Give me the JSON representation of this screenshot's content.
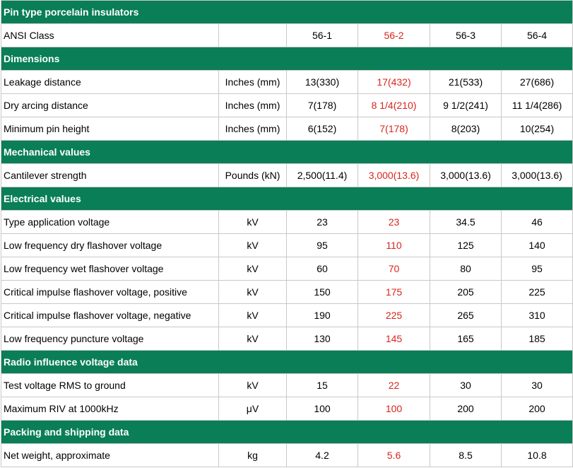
{
  "title": "Pin type porcelain insulators",
  "ansi": {
    "label": "ANSI Class",
    "classes": [
      "56-1",
      "56-2",
      "56-3",
      "56-4"
    ]
  },
  "accent_color": "#0a7e56",
  "highlight_color": "#d9251d",
  "sections": [
    {
      "title": "Dimensions",
      "rows": [
        {
          "label": "Leakage distance",
          "unit": "Inches (mm)",
          "values": [
            "13(330)",
            "17(432)",
            "21(533)",
            "27(686)"
          ]
        },
        {
          "label": "Dry arcing distance",
          "unit": "Inches (mm)",
          "values": [
            "7(178)",
            "8 1/4(210)",
            "9 1/2(241)",
            "11 1/4(286)"
          ]
        },
        {
          "label": "Minimum pin height",
          "unit": "Inches (mm)",
          "values": [
            "6(152)",
            "7(178)",
            "8(203)",
            "10(254)"
          ]
        }
      ]
    },
    {
      "title": "Mechanical values",
      "rows": [
        {
          "label": "Cantilever strength",
          "unit": "Pounds (kN)",
          "values": [
            "2,500(11.4)",
            "3,000(13.6)",
            "3,000(13.6)",
            "3,000(13.6)"
          ]
        }
      ]
    },
    {
      "title": "Electrical values",
      "rows": [
        {
          "label": "Type application voltage",
          "unit": "kV",
          "values": [
            "23",
            "23",
            "34.5",
            "46"
          ]
        },
        {
          "label": "Low frequency dry flashover voltage",
          "unit": "kV",
          "values": [
            "95",
            "110",
            "125",
            "140"
          ]
        },
        {
          "label": "Low frequency wet flashover voltage",
          "unit": "kV",
          "values": [
            "60",
            "70",
            "80",
            "95"
          ]
        },
        {
          "label": "Critical impulse flashover voltage, positive",
          "unit": "kV",
          "values": [
            "150",
            "175",
            "205",
            "225"
          ]
        },
        {
          "label": "Critical impulse flashover voltage, negative",
          "unit": "kV",
          "values": [
            "190",
            "225",
            "265",
            "310"
          ]
        },
        {
          "label": "Low frequency puncture voltage",
          "unit": "kV",
          "values": [
            "130",
            "145",
            "165",
            "185"
          ]
        }
      ]
    },
    {
      "title": "Radio influence voltage data",
      "rows": [
        {
          "label": "Test voltage RMS to ground",
          "unit": "kV",
          "values": [
            "15",
            "22",
            "30",
            "30"
          ]
        },
        {
          "label": "Maximum RIV at 1000kHz",
          "unit": "μV",
          "values": [
            "100",
            "100",
            "200",
            "200"
          ]
        }
      ]
    },
    {
      "title": "Packing and shipping data",
      "rows": [
        {
          "label": "Net weight, approximate",
          "unit": "kg",
          "values": [
            "4.2",
            "5.6",
            "8.5",
            "10.8"
          ]
        }
      ]
    }
  ]
}
